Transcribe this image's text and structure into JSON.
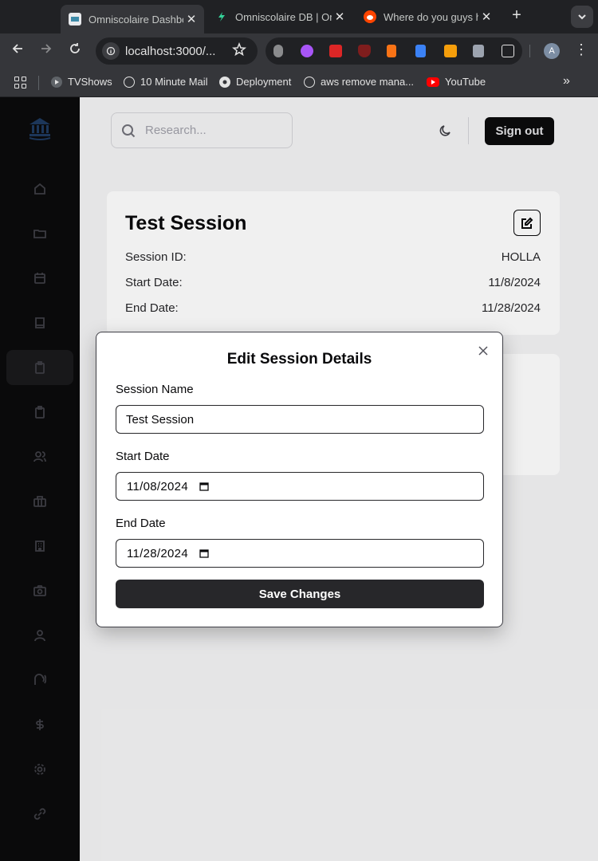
{
  "browser": {
    "tabs": [
      {
        "title": "Omniscolaire Dashboard",
        "active": true,
        "favicon_color": "#e8eaed"
      },
      {
        "title": "Omniscolaire DB | Omniscolaire",
        "active": false,
        "favicon_color": "#34d399"
      },
      {
        "title": "Where do you guys host",
        "active": false,
        "favicon_color": "#ff4500"
      }
    ],
    "url": "localhost:3000/...",
    "profile_initial": "A",
    "bookmarks": [
      {
        "label": "TVShows"
      },
      {
        "label": "10 Minute Mail"
      },
      {
        "label": "Deployment"
      },
      {
        "label": "aws remove mana..."
      },
      {
        "label": "YouTube"
      }
    ]
  },
  "app": {
    "search": {
      "placeholder": "Research..."
    },
    "signout_label": "Sign out",
    "session_card": {
      "title": "Test Session",
      "rows": [
        {
          "label": "Session ID:",
          "value": "HOLLA"
        },
        {
          "label": "Start Date:",
          "value": "11/8/2024"
        },
        {
          "label": "End Date:",
          "value": "11/28/2024"
        }
      ]
    },
    "sidebar": {
      "items": [
        "home-icon",
        "folder-icon",
        "calendar-icon",
        "book-icon",
        "clipboard-icon",
        "clipboard-icon",
        "users-icon",
        "briefcase-icon",
        "building-icon",
        "camera-icon",
        "user-icon",
        "audio-icon",
        "dollar-icon",
        "settings-icon",
        "link-icon"
      ],
      "active_index": 4
    }
  },
  "modal": {
    "title": "Edit Session Details",
    "name_label": "Session Name",
    "name_value": "Test Session",
    "start_label": "Start Date",
    "start_value": "11/08/2024",
    "end_label": "End Date",
    "end_value": "11/28/2024",
    "save_label": "Save Changes"
  }
}
